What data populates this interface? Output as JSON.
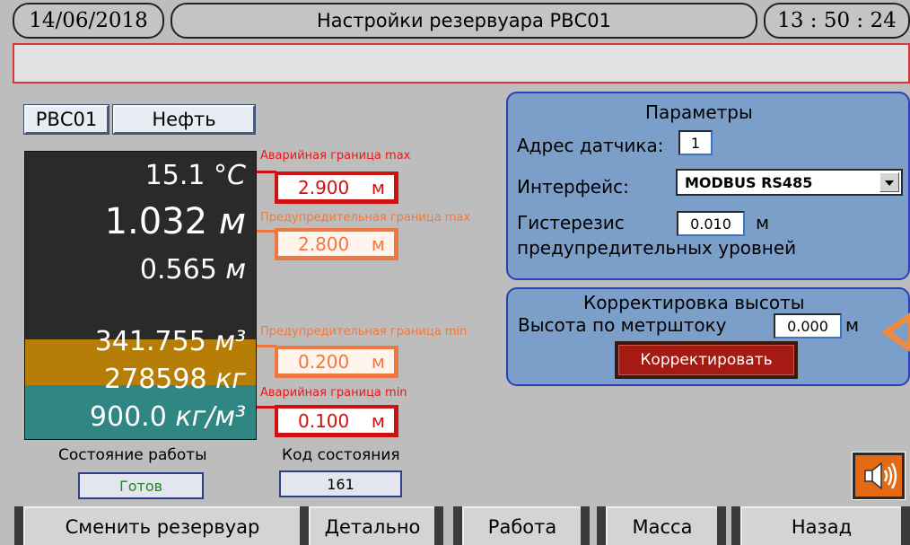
{
  "header": {
    "date": "14/06/2018",
    "title": "Настройки резервуара РВС01",
    "time": "13 : 50 : 24"
  },
  "message_bar": {
    "text": ""
  },
  "tank": {
    "id": "РВС01",
    "product": "Нефть",
    "temperature": {
      "value": "15.1",
      "unit": "°C"
    },
    "level": {
      "value": "1.032",
      "unit": "м"
    },
    "water_level": {
      "value": "0.565",
      "unit": "м"
    },
    "volume": {
      "value": "341.755",
      "unit": "м³"
    },
    "mass": {
      "value": "278598",
      "unit": "кг"
    },
    "density": {
      "value": "900.0",
      "unit": "кг/м³"
    },
    "fill_level_m": 1.032
  },
  "limits": {
    "alarm_max": {
      "label": "Аварийная граница max",
      "value": "2.900",
      "unit": "м"
    },
    "warn_max": {
      "label": "Предупредительная граница max",
      "value": "2.800",
      "unit": "м"
    },
    "warn_min": {
      "label": "Предупредительная граница min",
      "value": "0.200",
      "unit": "м"
    },
    "alarm_min": {
      "label": "Аварийная граница min",
      "value": "0.100",
      "unit": "м"
    }
  },
  "status": {
    "work_label": "Состояние работы",
    "work_value": "Готов",
    "code_label": "Код состояния",
    "code_value": "161"
  },
  "params": {
    "title": "Параметры",
    "sensor_address_label": "Адрес датчика:",
    "sensor_address": "1",
    "interface_label": "Интерфейс:",
    "interface_value": "MODBUS RS485",
    "hysteresis_label_1": "Гистерезис",
    "hysteresis_label_2": "предупредительных уровней",
    "hysteresis_value": "0.010",
    "hysteresis_unit": "м"
  },
  "correction": {
    "title": "Корректировка высоты",
    "rod_height_label": "Высота по метрштоку",
    "rod_height_value": "0.000",
    "rod_height_unit": "м",
    "button_label": "Корректировать"
  },
  "nav": {
    "change_tank": "Сменить резервуар",
    "details": "Детально",
    "work": "Работа",
    "mass": "Масса",
    "back": "Назад"
  },
  "colors": {
    "alarm": "#cf1111",
    "warning": "#f07840",
    "status_ok": "#1f8a1f",
    "panel": "#7b9fc9"
  },
  "icons": {
    "speaker": "speaker-icon"
  }
}
